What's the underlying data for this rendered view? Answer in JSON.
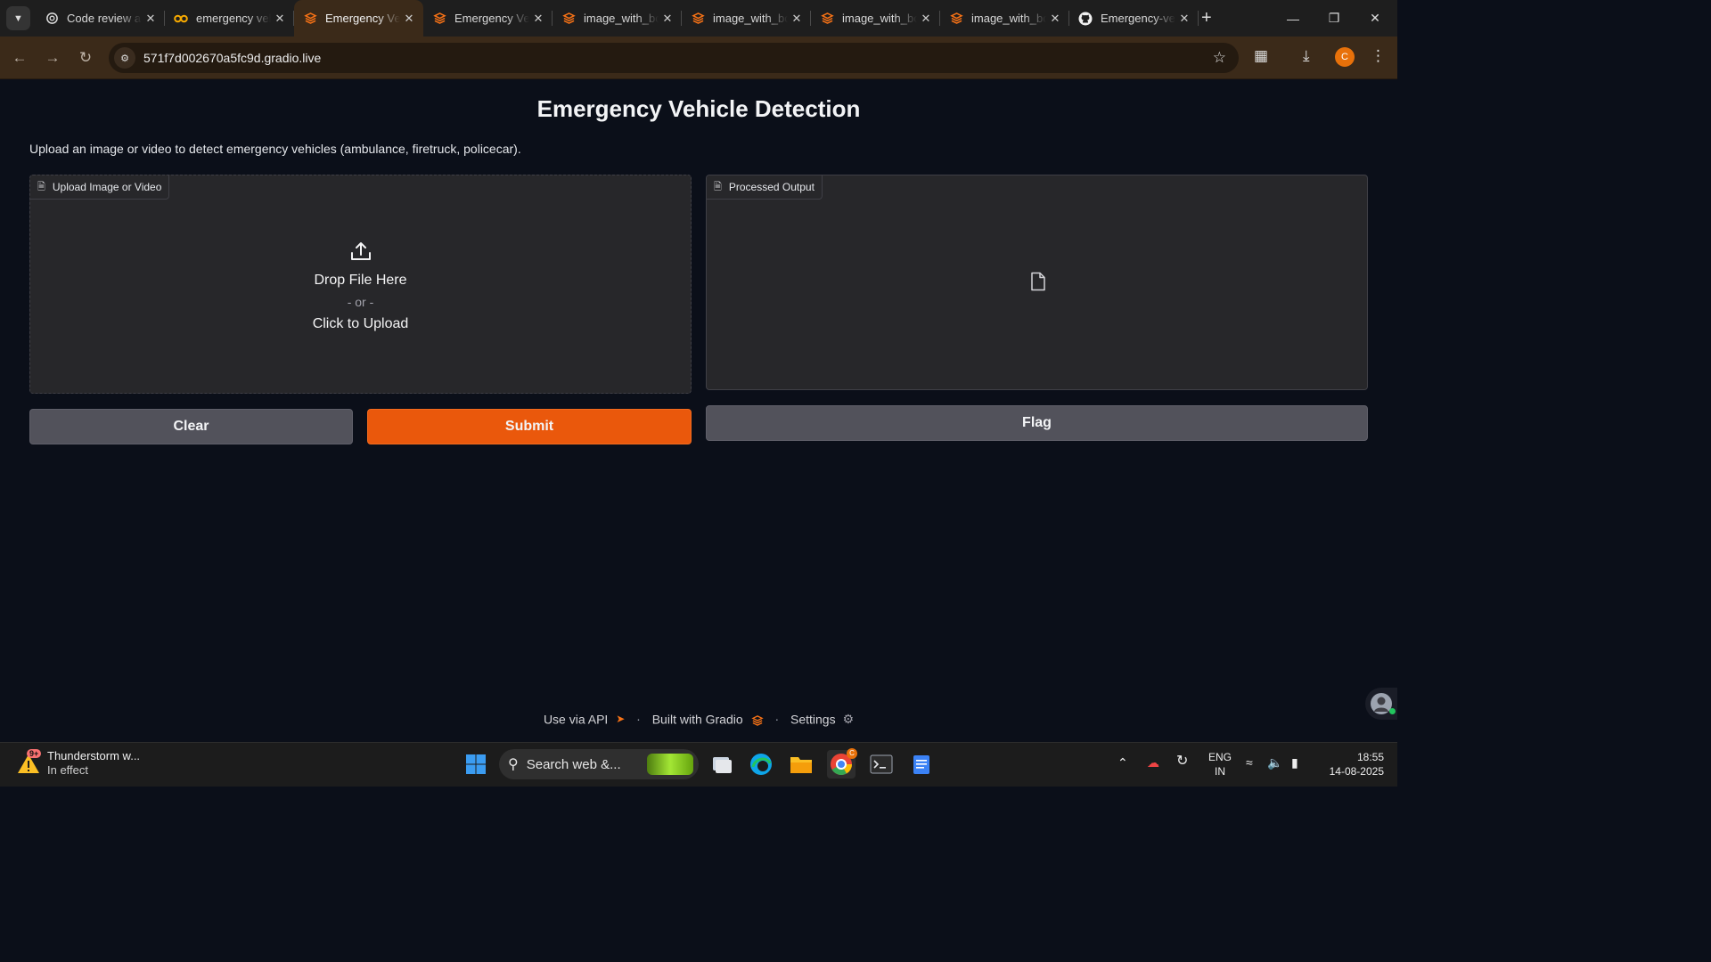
{
  "browser": {
    "tabs": [
      {
        "title": "Code review assistant",
        "icon": "openai-icon",
        "active": false
      },
      {
        "title": "emergency vehicle detection",
        "icon": "colab-icon",
        "active": false
      },
      {
        "title": "Emergency Vehicle Detection",
        "icon": "gradio-icon",
        "active": true
      },
      {
        "title": "Emergency Vehicle Detection",
        "icon": "gradio-icon",
        "active": false
      },
      {
        "title": "image_with_boxes",
        "icon": "gradio-icon",
        "active": false
      },
      {
        "title": "image_with_boxes",
        "icon": "gradio-icon",
        "active": false
      },
      {
        "title": "image_with_boxes",
        "icon": "gradio-icon",
        "active": false
      },
      {
        "title": "image_with_boxes",
        "icon": "gradio-icon",
        "active": false
      },
      {
        "title": "Emergency-vehicle-detection",
        "icon": "github-icon",
        "active": false
      }
    ],
    "url": "571f7d002670a5fc9d.gradio.live",
    "profile_initial": "C"
  },
  "app": {
    "title": "Emergency Vehicle Detection",
    "description": "Upload an image or video to detect emergency vehicles (ambulance, firetruck, policecar).",
    "input_panel": {
      "label": "Upload Image or Video",
      "drop_text": "Drop File Here",
      "or_text": "- or -",
      "click_text": "Click to Upload"
    },
    "output_panel": {
      "label": "Processed Output"
    },
    "buttons": {
      "clear": "Clear",
      "submit": "Submit",
      "flag": "Flag"
    },
    "footer": {
      "api": "Use via API",
      "built": "Built with Gradio",
      "settings": "Settings"
    }
  },
  "taskbar": {
    "weather_title": "Thunderstorm w...",
    "weather_sub": "In effect",
    "weather_badge": "9+",
    "search_placeholder": "Search web &...",
    "language": "ENG",
    "region": "IN",
    "time": "18:55",
    "date": "14-08-2025",
    "chrome_badge": "C"
  },
  "colors": {
    "accent": "#ea580c",
    "page_bg": "#0b0f19",
    "panel_bg": "#27272a",
    "secondary_btn": "#52525b",
    "browser_frame": "#3b2a19"
  }
}
